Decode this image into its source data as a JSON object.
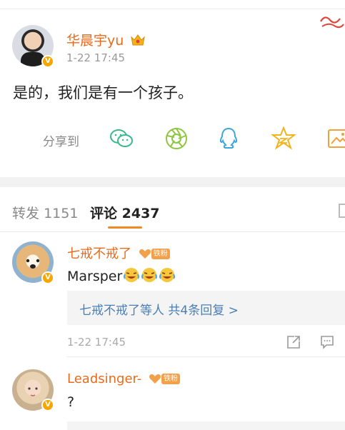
{
  "post": {
    "author": "华晨宇yu",
    "time": "1-22 17:45",
    "text": "是的，我们是有一个孩子。",
    "share_label": "分享到",
    "share_targets": [
      "wechat-icon",
      "moments-icon",
      "qq-icon",
      "qzone-icon",
      "image-share-icon"
    ]
  },
  "tabs": {
    "forward_label": "转发",
    "forward_count": "1151",
    "comment_label": "评论",
    "comment_count": "2437"
  },
  "comments": [
    {
      "name": "七戒不戒了",
      "badge": "铁粉",
      "text": "Marsper",
      "emoji": [
        "laugh-cry-emoji",
        "laugh-cry-emoji",
        "laugh-cry-emoji"
      ],
      "replies": "七戒不戒了等人  共4条回复 >",
      "time": "1-22 17:45"
    },
    {
      "name": "Leadsinger-",
      "badge": "铁粉",
      "text": "?"
    }
  ],
  "colors": {
    "accent": "#e86b1c",
    "link": "#4a7fb5",
    "tab_indicator": "#f08a24",
    "verified": "#f7a600",
    "fan_badge": "#f2a04a"
  }
}
